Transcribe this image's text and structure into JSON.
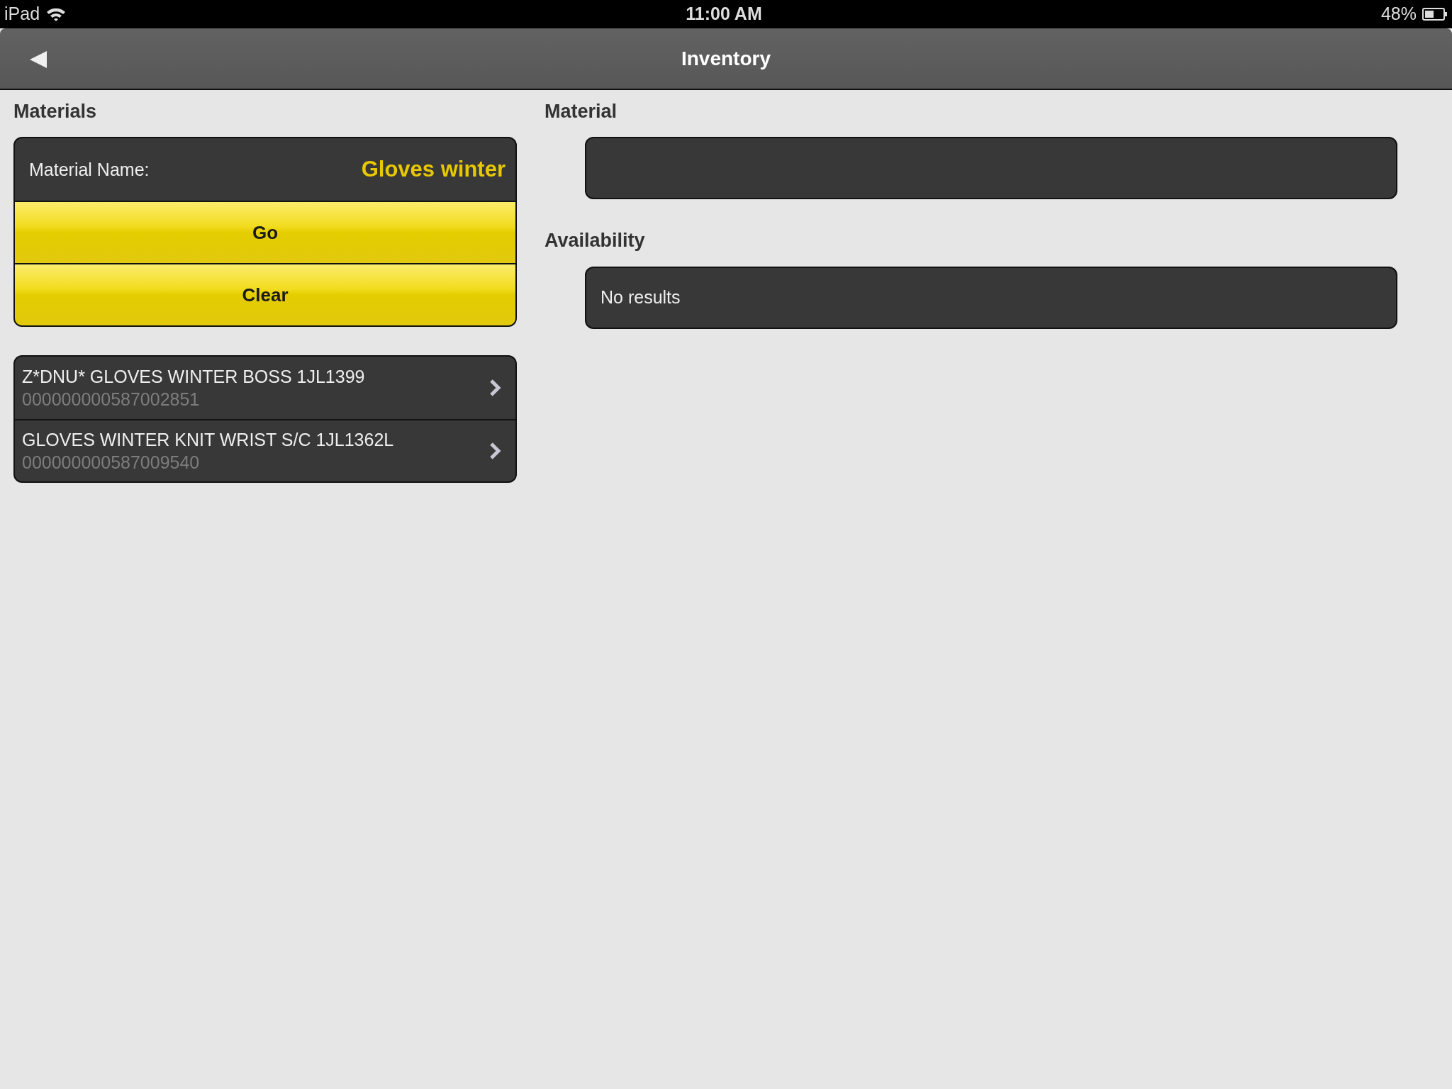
{
  "status_bar": {
    "device": "iPad",
    "time": "11:00 AM",
    "battery": "48%"
  },
  "nav_bar": {
    "title": "Inventory"
  },
  "materials": {
    "heading": "Materials",
    "field": {
      "label": "Material Name:",
      "value": "Gloves winter"
    },
    "buttons": [
      "Go",
      "Clear"
    ],
    "results": [
      {
        "name": "Z*DNU* GLOVES WINTER BOSS 1JL1399",
        "number": "000000000587002851"
      },
      {
        "name": "GLOVES WINTER KNIT WRIST S/C 1JL1362L",
        "number": "000000000587009540"
      }
    ]
  },
  "material": {
    "heading": "Material"
  },
  "availability": {
    "heading": "Availability",
    "message": "No results"
  }
}
